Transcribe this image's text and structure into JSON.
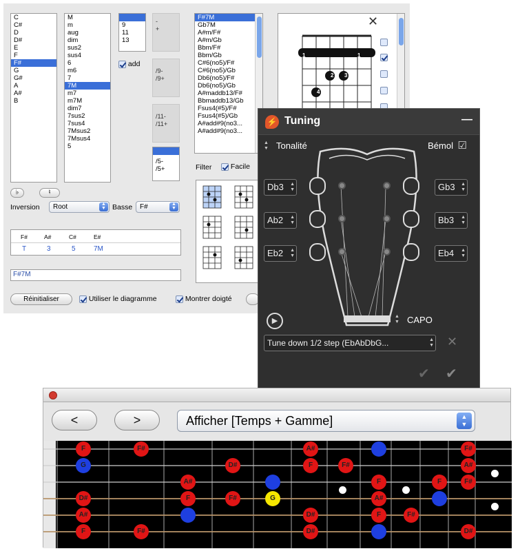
{
  "chord_window": {
    "roots": [
      "C",
      "C#",
      "D",
      "D#",
      "E",
      "F",
      "F#",
      "G",
      "G#",
      "A",
      "A#",
      "B"
    ],
    "root_selected": 6,
    "qualities": [
      "M",
      "m",
      "aug",
      "dim",
      "sus2",
      "sus4",
      "6",
      "m6",
      "7",
      "7M",
      "m7",
      "m7M",
      "dim7",
      "7sus2",
      "7sus4",
      "7Msus2",
      "7Msus4",
      "5"
    ],
    "quality_selected": 9,
    "extensions": [
      "9",
      "11",
      "13"
    ],
    "add_label": "add",
    "alt_box_1": [
      "-",
      "+"
    ],
    "alt_box_2": [
      "/9-",
      "/9+"
    ],
    "alt_box_3": [
      "/11-",
      "/11+"
    ],
    "alt_box_4": [
      "/5-",
      "/5+"
    ],
    "chord_names": [
      "F#7M",
      "Gb7M",
      "A#m/F#",
      "A#m/Gb",
      "Bbm/F#",
      "Bbm/Gb",
      "C#6(no5)/F#",
      "C#6(no5)/Gb",
      "Db6(no5)/F#",
      "Db6(no5)/Gb",
      "A#maddb13/F#",
      "Bbmaddb13/Gb",
      "Fsus4(#5)/F#",
      "Fsus4(#5)/Gb",
      "A#add#9(no3...",
      "A#add#9(no3..."
    ],
    "flat_button": "♭",
    "natural_button": "♮",
    "inversion_label": "Inversion",
    "inversion_value": "Root",
    "bass_label": "Basse",
    "bass_value": "F#",
    "notes_header": [
      "F#",
      "A#",
      "C#",
      "E#"
    ],
    "notes_degrees": [
      "T",
      "3",
      "5",
      "7M"
    ],
    "chord_field": "F#7M",
    "reset_button": "Réinitialiser",
    "use_diagram_label": "Utiliser le diagramme",
    "show_fingering_label": "Montrer doigté",
    "filter_label": "Filter",
    "easy_label": "Facile",
    "diagram_fingers": [
      "1",
      "1",
      "2",
      "3",
      "4"
    ]
  },
  "tuning_panel": {
    "title": "Tuning",
    "minimize": "—",
    "tonality_label": "Tonalité",
    "flat_label": "Bémol",
    "left_strings": [
      "Db3",
      "Ab2",
      "Eb2"
    ],
    "right_strings": [
      "Gb3",
      "Bb3",
      "Eb4"
    ],
    "capo_label": "CAPO",
    "preset_value": "Tune down 1/2 step (EbAbDbG...",
    "play_icon": "play-icon",
    "colors": {
      "panel": "#2f2f2f",
      "accent": "#e2562a"
    }
  },
  "fretboard_window": {
    "prev_button": "<",
    "next_button": ">",
    "display_select": "Afficher [Temps + Gamme]",
    "notes_row1": [
      "F",
      "F#",
      "A#",
      "F#"
    ],
    "notes_row2": [
      "G",
      "D#",
      "F",
      "F#",
      "A#"
    ],
    "notes_row3": [
      "A#",
      "F",
      "A#",
      "D#",
      "F",
      "F#"
    ],
    "notes_row4": [
      "D#",
      "F",
      "F#",
      "G",
      "A#",
      "G"
    ],
    "notes_row5": [
      "A#",
      "G",
      "D#",
      "F",
      "F#"
    ],
    "notes_row6": [
      "F",
      "F#",
      "D#",
      "G",
      "D#"
    ],
    "colors": {
      "red": "#e11515",
      "blue": "#1e3fe0",
      "yellow": "#f5e600"
    }
  }
}
